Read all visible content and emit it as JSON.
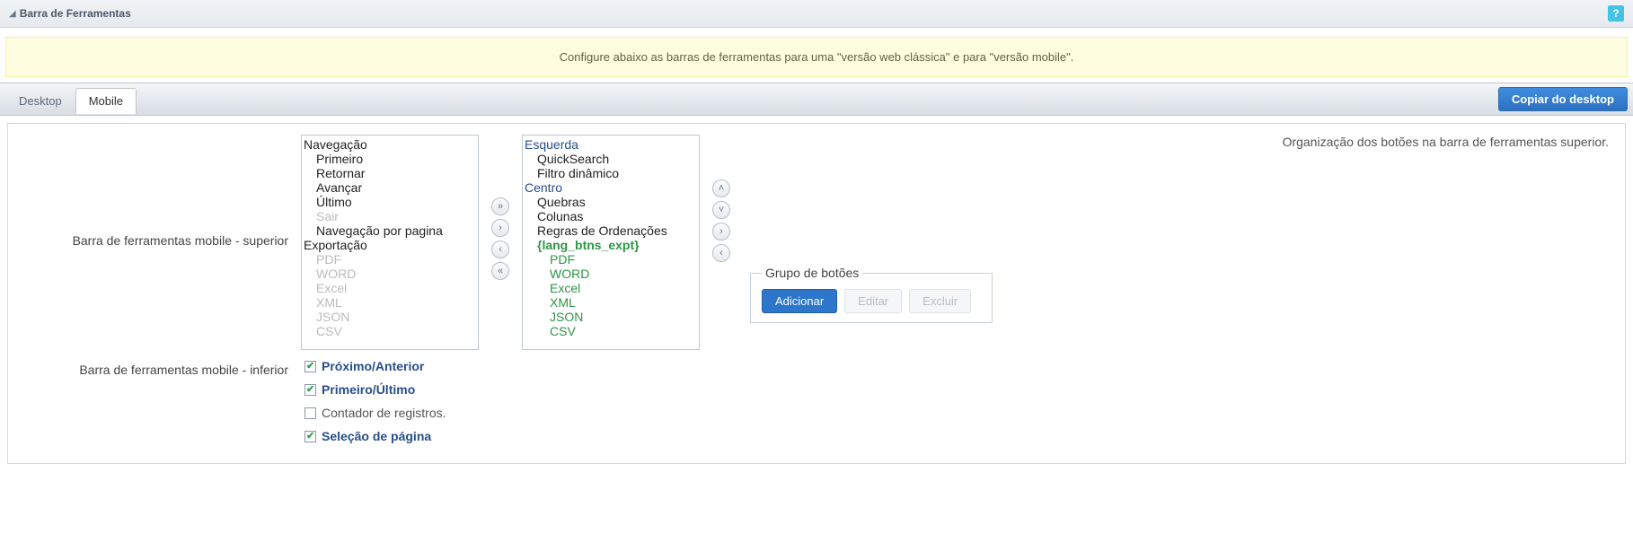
{
  "header": {
    "title": "Barra de Ferramentas"
  },
  "banner": {
    "text": "Configure abaixo as barras de ferramentas para uma \"versão web clássica\" e para \"versão mobile\"."
  },
  "tabs": {
    "desktop": "Desktop",
    "mobile": "Mobile"
  },
  "copy_btn": "Copiar do desktop",
  "labels": {
    "superior": "Barra de ferramentas mobile - superior",
    "inferior": "Barra de ferramentas mobile - inferior",
    "description": "Organização dos botões na barra de ferramentas superior."
  },
  "left_list": {
    "g1": "Navegação",
    "i1": "Primeiro",
    "i2": "Retornar",
    "i3": "Avançar",
    "i4": "Último",
    "i5": "Sair",
    "i6": "Navegação por pagina",
    "g2": "Exportação",
    "d1": "PDF",
    "d2": "WORD",
    "d3": "Excel",
    "d4": "XML",
    "d5": "JSON",
    "d6": "CSV"
  },
  "right_list": {
    "g1": "Esquerda",
    "i1": "QuickSearch",
    "i2": "Filtro dinâmico",
    "g2": "Centro",
    "i3": "Quebras",
    "i4": "Colunas",
    "i5": "Regras de Ordenações",
    "g3": "{lang_btns_expt}",
    "s1": "PDF",
    "s2": "WORD",
    "s3": "Excel",
    "s4": "XML",
    "s5": "JSON",
    "s6": "CSV"
  },
  "group_box": {
    "legend": "Grupo de botões",
    "add": "Adicionar",
    "edit": "Editar",
    "del": "Excluir"
  },
  "checks": {
    "c1": "Próximo/Anterior",
    "c2": "Primeiro/Último",
    "c3": "Contador de registros.",
    "c4": "Seleção de página"
  }
}
